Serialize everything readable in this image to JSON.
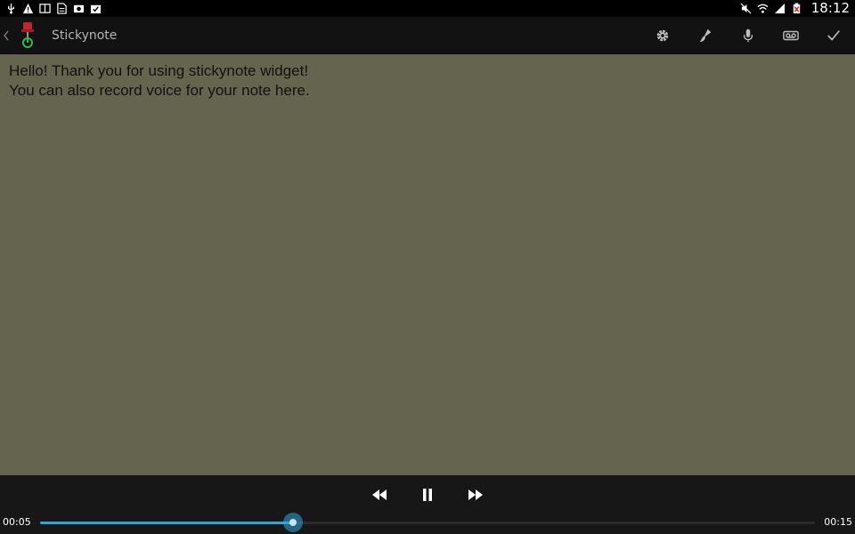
{
  "status_bar": {
    "left_icons": [
      "usb-icon",
      "warning-icon",
      "book-icon",
      "document-icon",
      "camera-icon",
      "check-image-icon"
    ],
    "right_icons": [
      "mute-icon",
      "wifi-icon",
      "signal-icon",
      "battery-icon"
    ],
    "clock": "18:12"
  },
  "action_bar": {
    "title": "Stickynote",
    "actions": [
      "settings-icon",
      "brush-icon",
      "microphone-icon",
      "voicemail-icon",
      "check-icon"
    ]
  },
  "note": {
    "lines": [
      "Hello! Thank you for using stickynote widget!",
      "You can also record voice for your note here."
    ],
    "background": "#65654f"
  },
  "player": {
    "current_time": "00:05",
    "total_time": "00:15",
    "progress": 0.327,
    "accent": "#33a6d9"
  }
}
